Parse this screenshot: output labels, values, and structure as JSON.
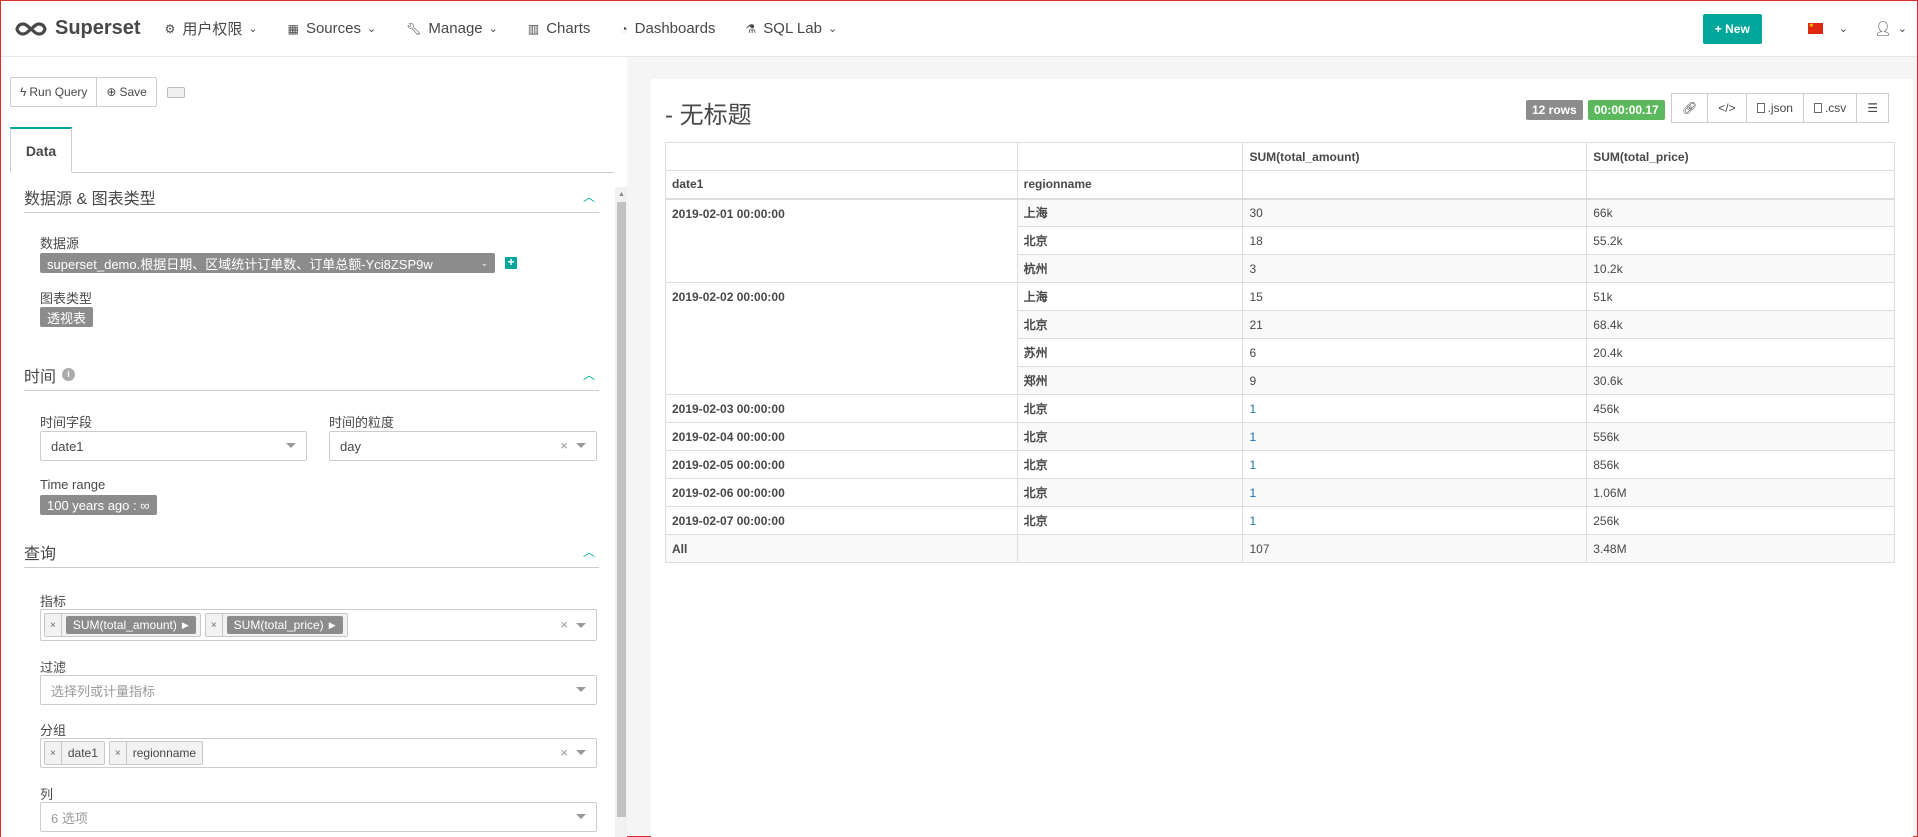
{
  "navbar": {
    "brand": "Superset",
    "items": [
      {
        "label": "用户权限",
        "icon": "cogs-icon",
        "has_caret": true
      },
      {
        "label": "Sources",
        "icon": "table-icon",
        "has_caret": true
      },
      {
        "label": "Manage",
        "icon": "wrench-icon",
        "has_caret": true
      },
      {
        "label": "Charts",
        "icon": "bar-chart-icon",
        "has_caret": false
      },
      {
        "label": "Dashboards",
        "icon": "dashboard-icon",
        "has_caret": false
      },
      {
        "label": "SQL Lab",
        "icon": "flask-icon",
        "has_caret": true
      }
    ],
    "new_button": "+ New"
  },
  "toolbar": {
    "run_query": "Run Query",
    "save": "Save"
  },
  "tabs": {
    "data": "Data"
  },
  "sections": {
    "datasource": {
      "title": "数据源 & 图表类型",
      "datasource_label": "数据源",
      "datasource_value": "superset_demo.根据日期、区域统计订单数、订单总额-Yci8ZSP9w",
      "viz_type_label": "图表类型",
      "viz_type_value": "透视表"
    },
    "time": {
      "title": "时间",
      "time_column_label": "时间字段",
      "time_column_value": "date1",
      "time_grain_label": "时间的粒度",
      "time_grain_value": "day",
      "time_range_label": "Time range",
      "time_range_value": "100 years ago : ∞"
    },
    "query": {
      "title": "查询",
      "metrics_label": "指标",
      "metrics": [
        "SUM(total_amount)",
        "SUM(total_price)"
      ],
      "filters_label": "过滤",
      "filters_placeholder": "选择列或计量指标",
      "groupby_label": "分组",
      "groupby": [
        "date1",
        "regionname"
      ],
      "columns_label": "列",
      "columns_placeholder": "6 选项"
    }
  },
  "chart": {
    "title": "- 无标题",
    "rows_badge": "12 rows",
    "time_badge": "00:00:00.17",
    "actions": {
      "json": ".json",
      "csv": ".csv"
    },
    "colors": {
      "accent": "#00a699",
      "rows_badge": "#8c8c8c",
      "time_badge": "#5cb85c"
    }
  },
  "chart_data": {
    "type": "table",
    "columns": [
      "date1",
      "regionname",
      "SUM(total_amount)",
      "SUM(total_price)"
    ],
    "rows": [
      {
        "date1": "2019-02-01 00:00:00",
        "region": "上海",
        "amount": "30",
        "price": "66k"
      },
      {
        "date1": "",
        "region": "北京",
        "amount": "18",
        "price": "55.2k"
      },
      {
        "date1": "",
        "region": "杭州",
        "amount": "3",
        "price": "10.2k"
      },
      {
        "date1": "2019-02-02 00:00:00",
        "region": "上海",
        "amount": "15",
        "price": "51k"
      },
      {
        "date1": "",
        "region": "北京",
        "amount": "21",
        "price": "68.4k"
      },
      {
        "date1": "",
        "region": "苏州",
        "amount": "6",
        "price": "20.4k"
      },
      {
        "date1": "",
        "region": "郑州",
        "amount": "9",
        "price": "30.6k"
      },
      {
        "date1": "2019-02-03 00:00:00",
        "region": "北京",
        "amount": "1",
        "price": "456k"
      },
      {
        "date1": "2019-02-04 00:00:00",
        "region": "北京",
        "amount": "1",
        "price": "556k"
      },
      {
        "date1": "2019-02-05 00:00:00",
        "region": "北京",
        "amount": "1",
        "price": "856k"
      },
      {
        "date1": "2019-02-06 00:00:00",
        "region": "北京",
        "amount": "1",
        "price": "1.06M"
      },
      {
        "date1": "2019-02-07 00:00:00",
        "region": "北京",
        "amount": "1",
        "price": "256k"
      }
    ],
    "total": {
      "label": "All",
      "amount": "107",
      "price": "3.48M"
    }
  }
}
